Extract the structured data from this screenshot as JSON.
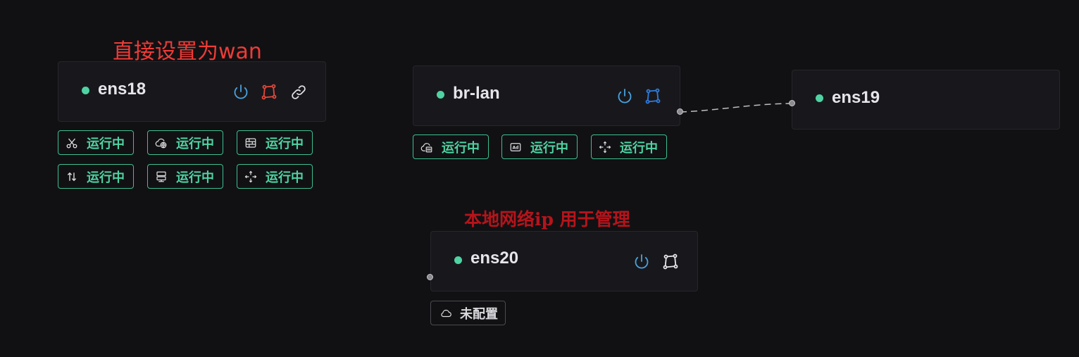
{
  "annotations": {
    "wan_note": "直接设置为wan",
    "mgmt_note": "本地网络ip 用于管理"
  },
  "nodes": {
    "ens18": {
      "name": "ens18",
      "status_color": "#4fd3a2",
      "icons": [
        "power-icon",
        "topology-icon",
        "link-icon"
      ],
      "badges": [
        {
          "icon": "scissors-icon",
          "label": "运行中"
        },
        {
          "icon": "cloud-globe-icon",
          "label": "运行中"
        },
        {
          "icon": "firewall-icon",
          "label": "运行中"
        },
        {
          "icon": "up-down-arrows-icon",
          "label": "运行中"
        },
        {
          "icon": "server-icon",
          "label": "运行中"
        },
        {
          "icon": "move-arrows-icon",
          "label": "运行中"
        }
      ]
    },
    "br_lan": {
      "name": "br-lan",
      "status_color": "#4fd3a2",
      "icons": [
        "power-icon",
        "topology-icon"
      ],
      "badges": [
        {
          "icon": "cloud-server-icon",
          "label": "运行中"
        },
        {
          "icon": "ad-block-icon",
          "label": "运行中"
        },
        {
          "icon": "move-arrows-icon",
          "label": "运行中"
        }
      ]
    },
    "ens19": {
      "name": "ens19",
      "status_color": "#4fd3a2"
    },
    "ens20": {
      "name": "ens20",
      "status_color": "#4fd3a2",
      "icons": [
        "power-icon",
        "topology-icon"
      ],
      "badges": [
        {
          "icon": "cloud-icon",
          "label": "未配置"
        }
      ]
    }
  },
  "colors": {
    "background": "#111114",
    "running": "#4fd3a2",
    "power_icon": "#4aa3e0",
    "wan_topology_icon": "#e5483a",
    "lan_topology_icon": "#2f7de1",
    "wan_note": "#ef3b36",
    "mgmt_note": "#b5141b"
  }
}
